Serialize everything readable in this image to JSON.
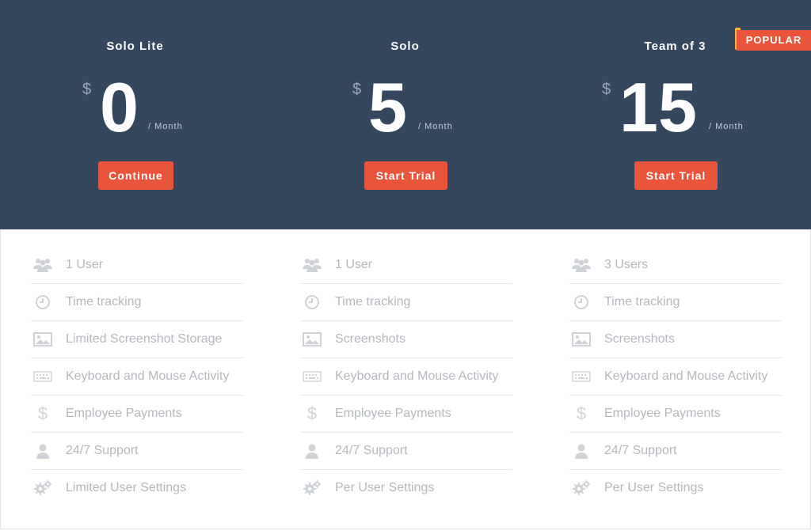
{
  "ribbon": {
    "label": "POPULAR"
  },
  "plans": [
    {
      "name": "Solo Lite",
      "currency": "$",
      "amount": "0",
      "period": "/ Month",
      "cta": "Continue",
      "features": [
        {
          "icon": "users-icon",
          "label": "1 User"
        },
        {
          "icon": "clock-icon",
          "label": "Time tracking"
        },
        {
          "icon": "image-icon",
          "label": "Limited Screenshot Storage"
        },
        {
          "icon": "keyboard-icon",
          "label": "Keyboard and Mouse Activity"
        },
        {
          "icon": "dollar-icon",
          "label": "Employee Payments"
        },
        {
          "icon": "user-icon",
          "label": "24/7 Support"
        },
        {
          "icon": "gears-icon",
          "label": "Limited User Settings"
        }
      ]
    },
    {
      "name": "Solo",
      "currency": "$",
      "amount": "5",
      "period": "/ Month",
      "cta": "Start Trial",
      "features": [
        {
          "icon": "users-icon",
          "label": "1 User"
        },
        {
          "icon": "clock-icon",
          "label": "Time tracking"
        },
        {
          "icon": "image-icon",
          "label": "Screenshots"
        },
        {
          "icon": "keyboard-icon",
          "label": "Keyboard and Mouse Activity"
        },
        {
          "icon": "dollar-icon",
          "label": "Employee Payments"
        },
        {
          "icon": "user-icon",
          "label": "24/7 Support"
        },
        {
          "icon": "gears-icon",
          "label": "Per User Settings"
        }
      ]
    },
    {
      "name": "Team of 3",
      "currency": "$",
      "amount": "15",
      "period": "/ Month",
      "cta": "Start Trial",
      "features": [
        {
          "icon": "users-icon",
          "label": "3 Users"
        },
        {
          "icon": "clock-icon",
          "label": "Time tracking"
        },
        {
          "icon": "image-icon",
          "label": "Screenshots"
        },
        {
          "icon": "keyboard-icon",
          "label": "Keyboard and Mouse Activity"
        },
        {
          "icon": "dollar-icon",
          "label": "Employee Payments"
        },
        {
          "icon": "user-icon",
          "label": "24/7 Support"
        },
        {
          "icon": "gears-icon",
          "label": "Per User Settings"
        }
      ]
    }
  ]
}
